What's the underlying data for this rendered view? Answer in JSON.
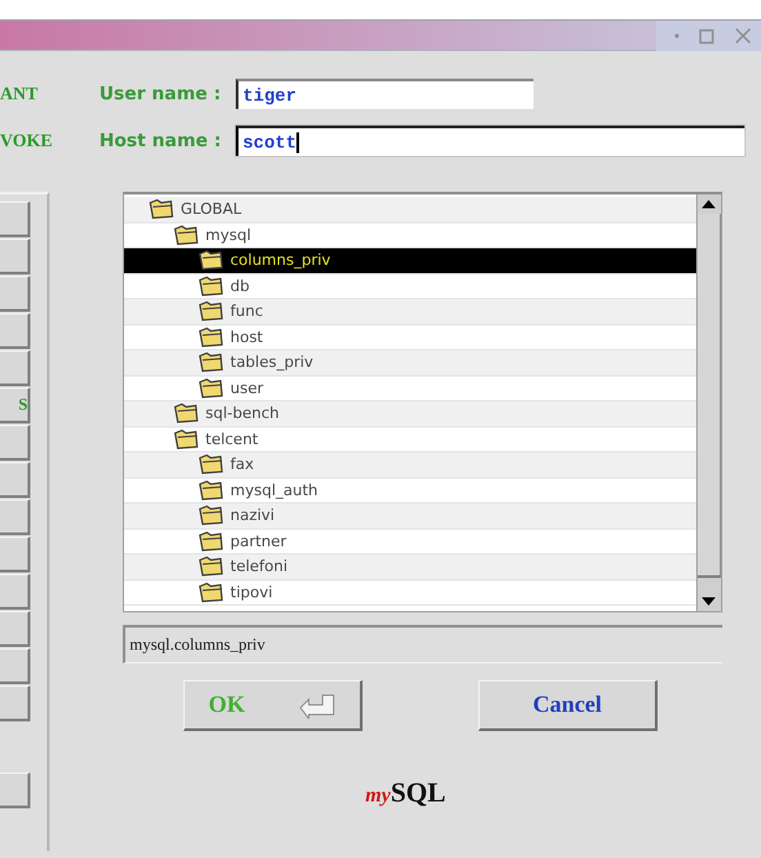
{
  "form": {
    "side_labels": [
      "ANT",
      "VOKE"
    ],
    "fields": [
      {
        "label": "User name :",
        "value": "tiger",
        "focused": false
      },
      {
        "label": "Host name :",
        "value": "scott",
        "focused": true
      }
    ]
  },
  "left_panel": {
    "labeled_button": {
      "label": "S"
    }
  },
  "tree": {
    "items": [
      {
        "label": "GLOBAL",
        "selected": false,
        "children": [
          {
            "label": "mysql",
            "selected": false,
            "children": [
              {
                "label": "columns_priv",
                "selected": true
              },
              {
                "label": "db",
                "selected": false
              },
              {
                "label": "func",
                "selected": false
              },
              {
                "label": "host",
                "selected": false
              },
              {
                "label": "tables_priv",
                "selected": false
              },
              {
                "label": "user",
                "selected": false
              }
            ]
          },
          {
            "label": "sql-bench",
            "selected": false
          },
          {
            "label": "telcent",
            "selected": false,
            "children": [
              {
                "label": "fax",
                "selected": false
              },
              {
                "label": "mysql_auth",
                "selected": false
              },
              {
                "label": "nazivi",
                "selected": false
              },
              {
                "label": "partner",
                "selected": false
              },
              {
                "label": "telefoni",
                "selected": false
              },
              {
                "label": "tipovi",
                "selected": false
              }
            ]
          }
        ]
      }
    ]
  },
  "status": "mysql.columns_priv",
  "buttons": [
    {
      "label": "OK",
      "kind": "ok"
    },
    {
      "label": "Cancel",
      "kind": "cancel"
    }
  ],
  "logo": {
    "prefix": "my",
    "name": "SQL"
  }
}
